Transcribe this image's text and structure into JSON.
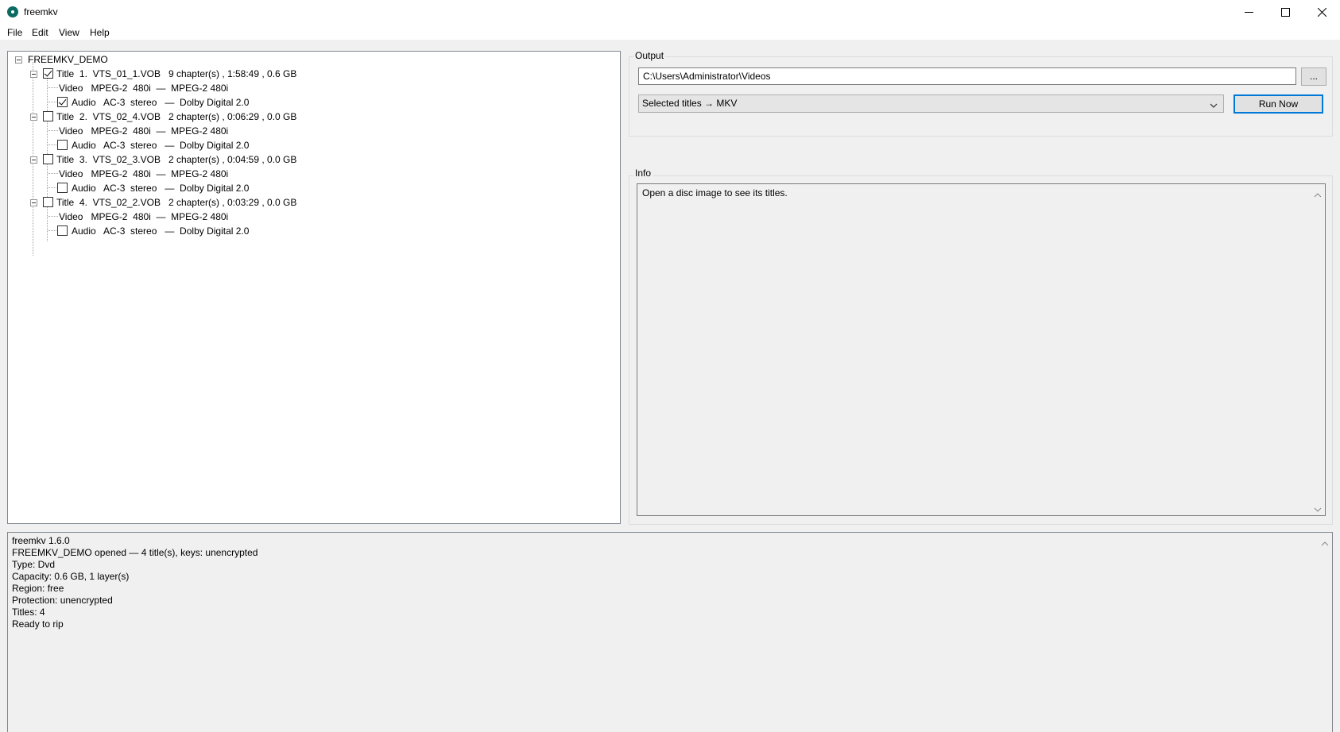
{
  "window": {
    "title": "freemkv"
  },
  "menu": [
    "File",
    "Edit",
    "View",
    "Help"
  ],
  "tree": {
    "root": "FREEMKV_DEMO",
    "titles": [
      {
        "label": "Title  1.  VTS_01_1.VOB   9 chapter(s) , 1:58:49 , 0.6 GB",
        "checked": true,
        "video": "Video   MPEG-2  480i  —  MPEG-2 480i",
        "audio": "Audio   AC-3  stereo   —  Dolby Digital 2.0",
        "audio_checked": true
      },
      {
        "label": "Title  2.  VTS_02_4.VOB   2 chapter(s) , 0:06:29 , 0.0 GB",
        "checked": false,
        "video": "Video   MPEG-2  480i  —  MPEG-2 480i",
        "audio": "Audio   AC-3  stereo   —  Dolby Digital 2.0",
        "audio_checked": false
      },
      {
        "label": "Title  3.  VTS_02_3.VOB   2 chapter(s) , 0:04:59 , 0.0 GB",
        "checked": false,
        "video": "Video   MPEG-2  480i  —  MPEG-2 480i",
        "audio": "Audio   AC-3  stereo   —  Dolby Digital 2.0",
        "audio_checked": false
      },
      {
        "label": "Title  4.  VTS_02_2.VOB   2 chapter(s) , 0:03:29 , 0.0 GB",
        "checked": false,
        "video": "Video   MPEG-2  480i  —  MPEG-2 480i",
        "audio": "Audio   AC-3  stereo   —  Dolby Digital 2.0",
        "audio_checked": false
      }
    ]
  },
  "output": {
    "group_label": "Output",
    "path": "C:\\Users\\Administrator\\Videos",
    "browse_label": "...",
    "mode_selected": "Selected titles → MKV",
    "run_label": "Run Now"
  },
  "info": {
    "group_label": "Info",
    "text": "Open a disc image to see its titles."
  },
  "log": [
    "freemkv 1.6.0",
    "FREEMKV_DEMO opened — 4 title(s), keys: unencrypted",
    "Type: Dvd",
    "Capacity: 0.6 GB, 1 layer(s)",
    "Region: free",
    "Protection: unencrypted",
    "Titles: 4",
    "Ready to rip"
  ],
  "icons": {
    "app": "freemkv-app-icon",
    "minimize": "minimize-icon",
    "maximize": "maximize-icon",
    "close": "close-icon",
    "dropdown": "chevron-down-icon",
    "scroll_up": "scroll-up-arrow-icon",
    "scroll_down": "scroll-down-arrow-icon"
  },
  "colors": {
    "accent": "#0078d7",
    "app_icon": "#0b6b63"
  }
}
